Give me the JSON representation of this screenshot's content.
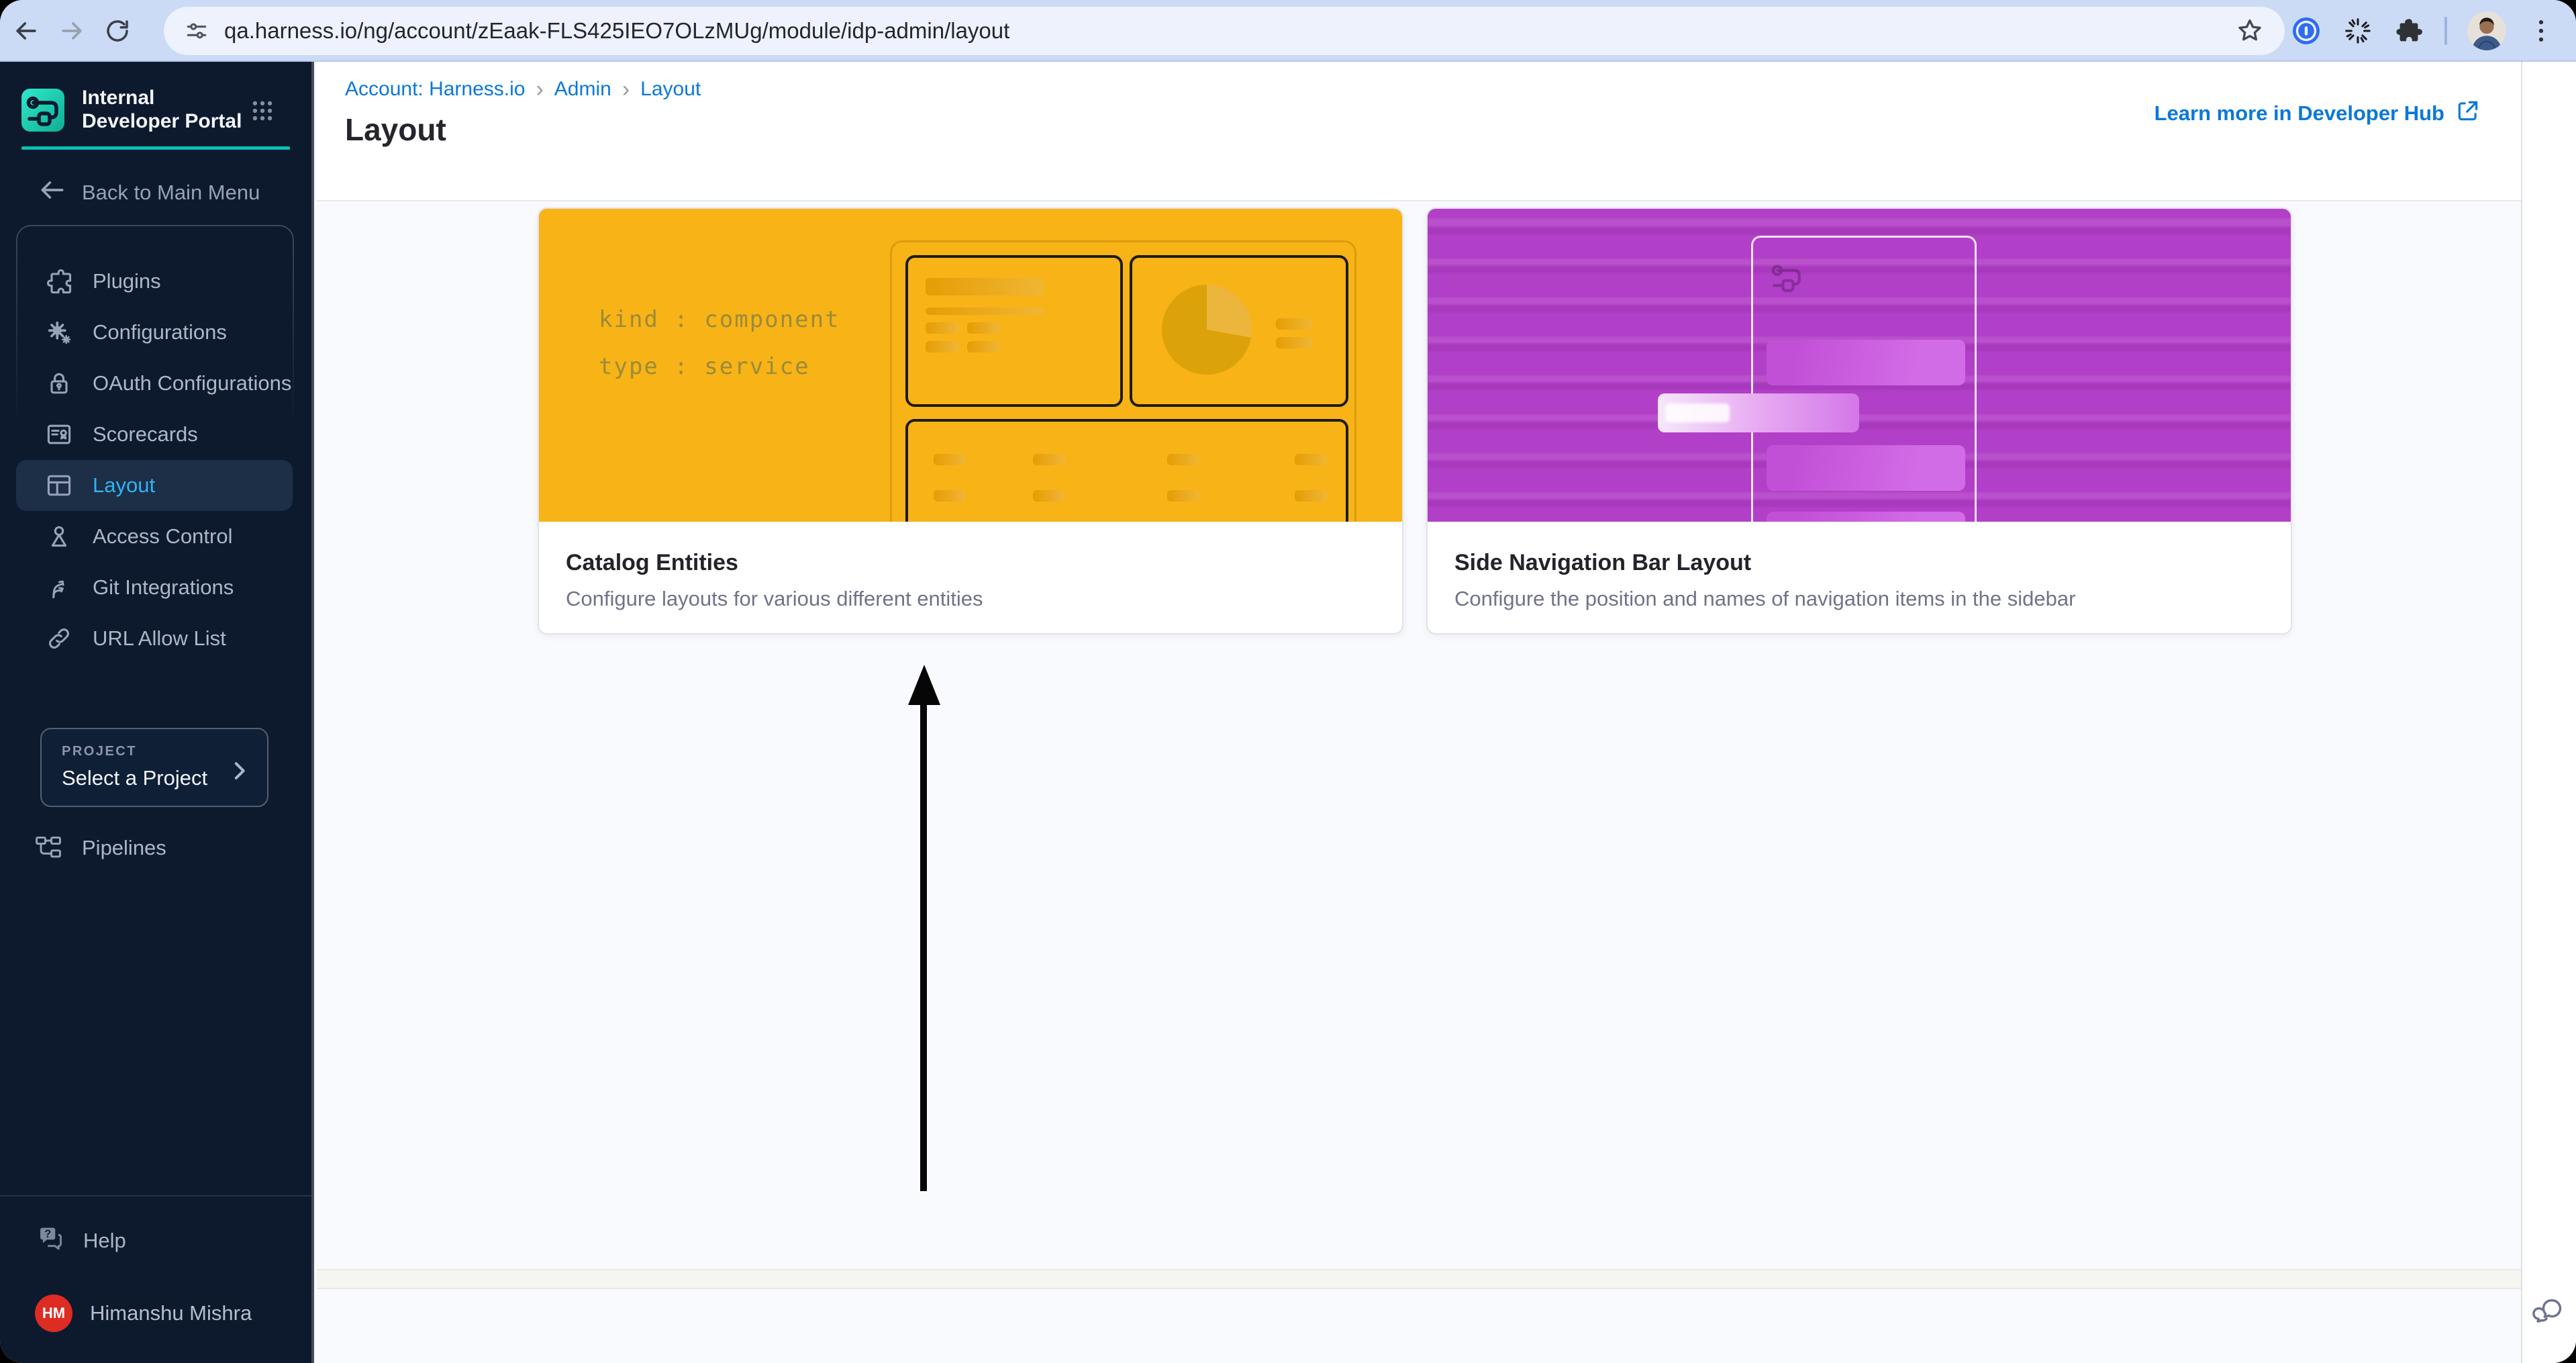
{
  "colors": {
    "chrome_bg": "#cbdbf6",
    "sidebar_bg": "#0d1a2e",
    "sidebar_selected_bg": "#1d2e47",
    "selected_text": "#2db5f4",
    "accent_teal": "#0ac0ae",
    "link_blue": "#0b78d8",
    "card_yellow": "#f8b317",
    "card_purple": "#b23fc7",
    "avatar_red": "#dd2c22"
  },
  "browser": {
    "url": "qa.harness.io/ng/account/zEaak-FLS425IEO7OLzMUg/module/idp-admin/layout",
    "icons": [
      "back-icon",
      "forward-icon",
      "reload-icon",
      "tune-icon",
      "star-icon",
      "onepassword-icon",
      "spinner-icon",
      "extensions-puzzle-icon",
      "profile-avatar",
      "kebab-menu-icon"
    ]
  },
  "sidebar": {
    "product_title": "Internal Developer Portal",
    "back_label": "Back to Main Menu",
    "items": [
      {
        "label": "Plugins",
        "icon": "puzzle-icon"
      },
      {
        "label": "Configurations",
        "icon": "gears-icon"
      },
      {
        "label": "OAuth Configurations",
        "icon": "lock-icon"
      },
      {
        "label": "Scorecards",
        "icon": "scorecard-icon"
      },
      {
        "label": "Layout",
        "icon": "layout-icon",
        "selected": true
      },
      {
        "label": "Access Control",
        "icon": "person-icon"
      },
      {
        "label": "Git Integrations",
        "icon": "branch-icon"
      },
      {
        "label": "URL Allow List",
        "icon": "link-icon"
      }
    ],
    "project_label": "PROJECT",
    "project_value": "Select a Project",
    "pipelines_label": "Pipelines",
    "help_label": "Help",
    "user_name": "Himanshu Mishra",
    "user_initials": "HM"
  },
  "header": {
    "breadcrumb": [
      "Account: Harness.io",
      "Admin",
      "Layout"
    ],
    "breadcrumb_separator": "›",
    "title": "Layout",
    "learn_more": "Learn more in Developer Hub"
  },
  "cards": [
    {
      "title": "Catalog Entities",
      "description": "Configure layouts for various different entities",
      "mock_line_1": "kind : component",
      "mock_line_2": "type : service"
    },
    {
      "title": "Side Navigation Bar Layout",
      "description": "Configure the position and names of navigation items in the sidebar"
    }
  ]
}
